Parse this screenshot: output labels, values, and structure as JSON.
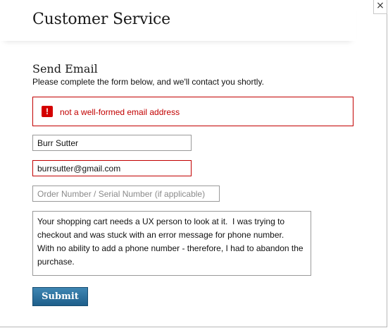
{
  "header": {
    "title": "Customer Service",
    "close_icon": "close-icon",
    "close_label": "×"
  },
  "form": {
    "section_title": "Send Email",
    "intro": "Please complete the form below, and we'll contact you shortly.",
    "error": {
      "icon": "!",
      "message": "not a well-formed email address",
      "color": "#c20000"
    },
    "name_value": "Burr Sutter",
    "email_value": "burrsutter@gmail.com",
    "order_placeholder": "Order Number / Serial Number (if applicable)",
    "message_value": "Your shopping cart needs a UX person to look at it.  I was trying to checkout and was stuck with an error message for phone number.\nWith no ability to add a phone number - therefore, I had to abandon the purchase.",
    "submit_label": "Submit",
    "submit_color": "#2a6f9e"
  }
}
